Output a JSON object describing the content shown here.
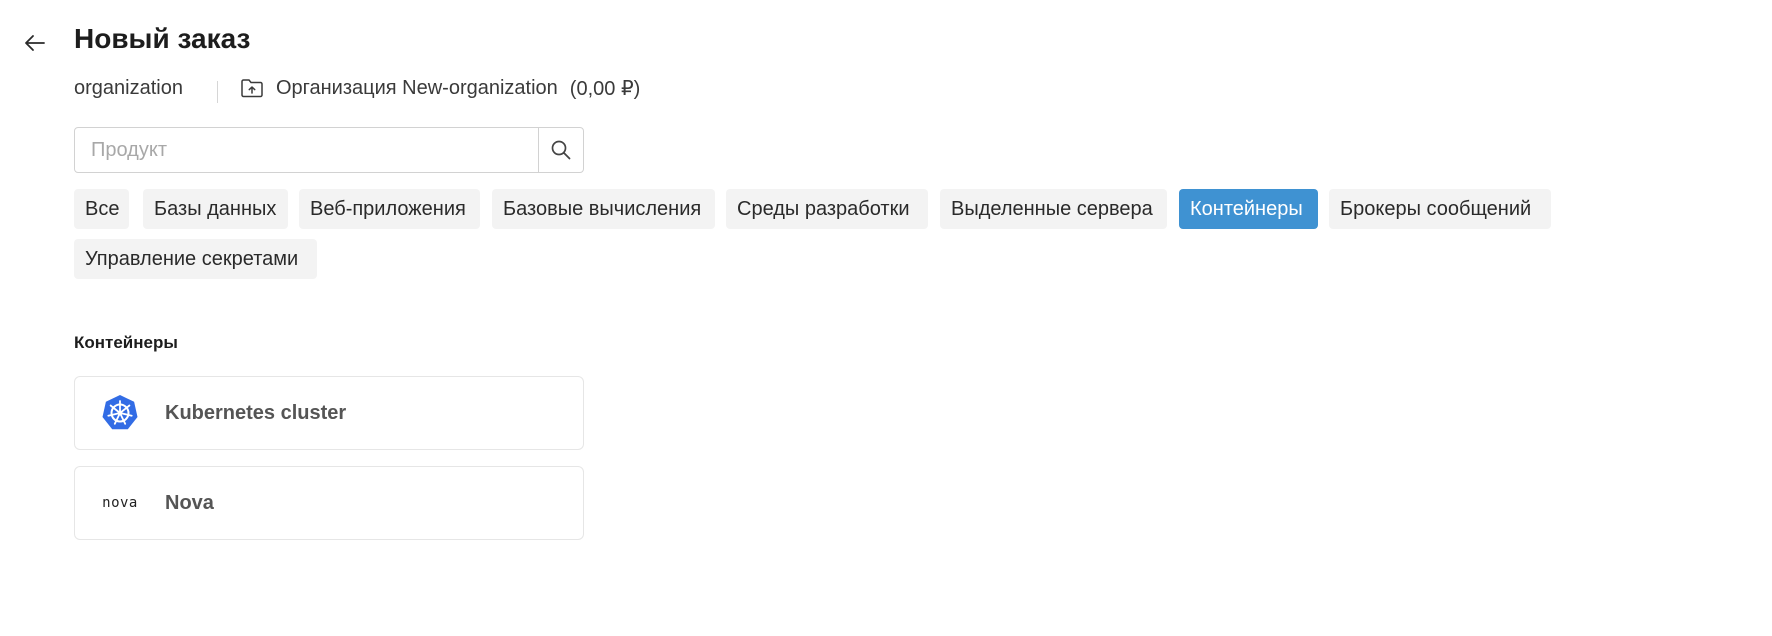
{
  "header": {
    "title": "Новый заказ"
  },
  "context": {
    "org_label": "organization",
    "org_name": "Организация New-organization",
    "org_balance": "(0,00 ₽)"
  },
  "search": {
    "placeholder": "Продукт",
    "value": ""
  },
  "categories": [
    {
      "label": "Все",
      "active": false
    },
    {
      "label": "Базы данных",
      "active": false
    },
    {
      "label": "Веб-приложения",
      "active": false
    },
    {
      "label": "Базовые вычисления",
      "active": false
    },
    {
      "label": "Среды разработки",
      "active": false
    },
    {
      "label": "Выделенные сервера",
      "active": false
    },
    {
      "label": "Контейнеры",
      "active": true
    },
    {
      "label": "Брокеры сообщений",
      "active": false
    },
    {
      "label": "Управление секретами",
      "active": false
    }
  ],
  "section": {
    "title": "Контейнеры"
  },
  "products": [
    {
      "label": "Kubernetes cluster",
      "icon": "kubernetes-icon"
    },
    {
      "label": "Nova",
      "icon": "nova-logo",
      "logo_text": "nova"
    }
  ],
  "colors": {
    "accent": "#3f92d2",
    "chip_bg": "#f3f3f3",
    "kubernetes_blue": "#326ce5"
  }
}
